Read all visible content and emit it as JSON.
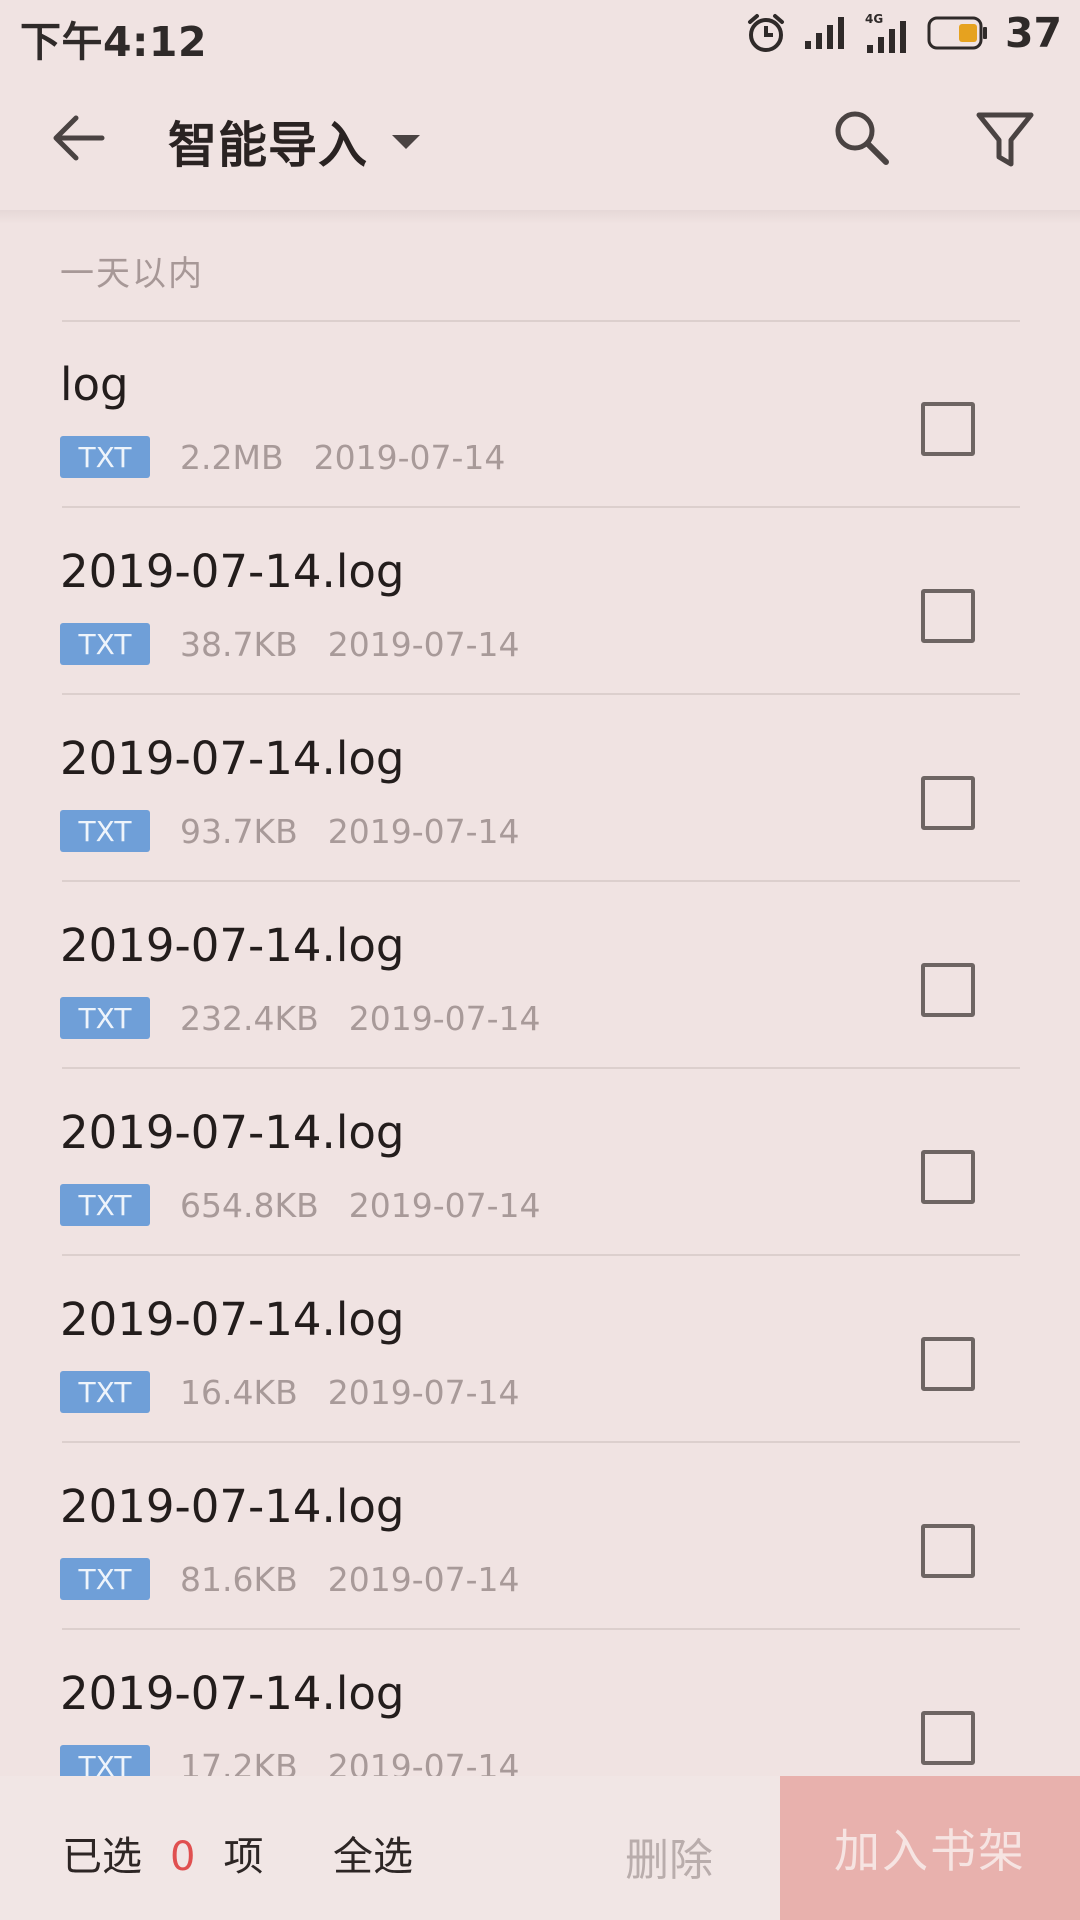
{
  "status_bar": {
    "time": "下午4:12",
    "battery_percent": "37",
    "network_label": "4G",
    "icons": [
      "alarm-clock-icon",
      "signal-icon",
      "4g-signal-icon",
      "battery-icon"
    ]
  },
  "toolbar": {
    "title": "智能导入",
    "icons": [
      "back-arrow-icon",
      "dropdown-caret-icon",
      "search-icon",
      "filter-icon"
    ]
  },
  "list": {
    "section_header": "一天以内",
    "items": [
      {
        "name": "log",
        "type": "TXT",
        "size": "2.2MB",
        "date": "2019-07-14",
        "checked": false
      },
      {
        "name": "2019-07-14.log",
        "type": "TXT",
        "size": "38.7KB",
        "date": "2019-07-14",
        "checked": false
      },
      {
        "name": "2019-07-14.log",
        "type": "TXT",
        "size": "93.7KB",
        "date": "2019-07-14",
        "checked": false
      },
      {
        "name": "2019-07-14.log",
        "type": "TXT",
        "size": "232.4KB",
        "date": "2019-07-14",
        "checked": false
      },
      {
        "name": "2019-07-14.log",
        "type": "TXT",
        "size": "654.8KB",
        "date": "2019-07-14",
        "checked": false
      },
      {
        "name": "2019-07-14.log",
        "type": "TXT",
        "size": "16.4KB",
        "date": "2019-07-14",
        "checked": false
      },
      {
        "name": "2019-07-14.log",
        "type": "TXT",
        "size": "81.6KB",
        "date": "2019-07-14",
        "checked": false
      },
      {
        "name": "2019-07-14.log",
        "type": "TXT",
        "size": "17.2KB",
        "date": "2019-07-14",
        "checked": false
      }
    ]
  },
  "bottom_bar": {
    "selected_prefix": "已选",
    "selected_count": "0",
    "selected_suffix": "项",
    "select_all": "全选",
    "delete": "删除",
    "add_to_shelf": "加入书架"
  },
  "colors": {
    "background": "#f0e3e2",
    "badge": "#6f9fd8",
    "count_accent": "#e05050",
    "primary_button": "#e8b1ad"
  }
}
